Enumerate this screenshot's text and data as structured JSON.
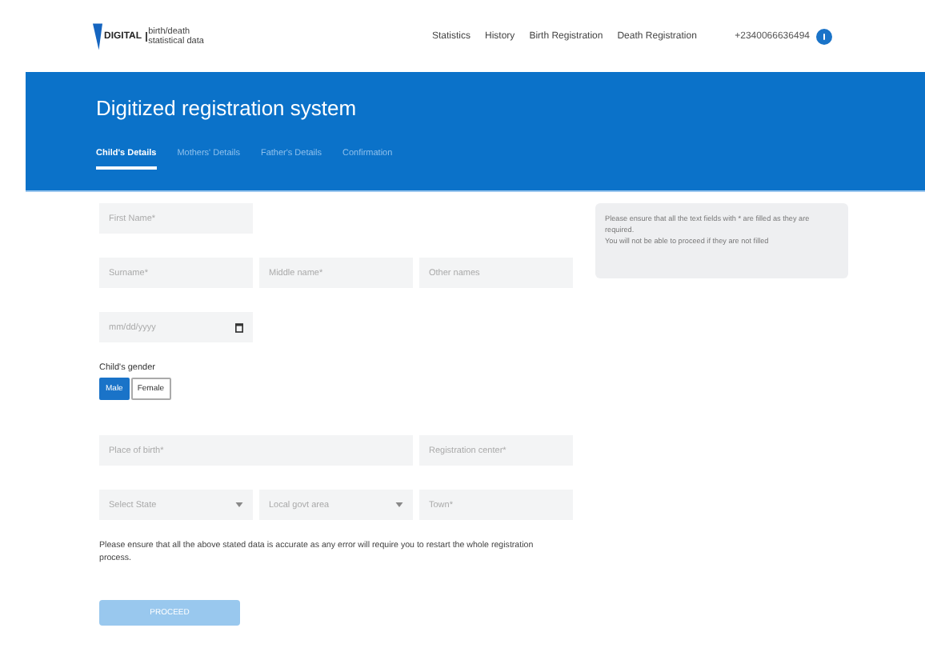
{
  "logo": {
    "mark": "DIGITAL",
    "line_1": "birth/death",
    "line_2": "statistical data"
  },
  "nav": [
    "Statistics",
    "History",
    "Birth Registration",
    "Death Registration"
  ],
  "phone": "+2340066636494",
  "banner": {
    "title": "Digitized registration system"
  },
  "tabs": [
    {
      "label": "Child's Details",
      "selected": true
    },
    {
      "label": "Mothers' Details",
      "selected": false
    },
    {
      "label": "Father's Details",
      "selected": false
    },
    {
      "label": "Confirmation",
      "selected": false
    }
  ],
  "rows": [
    [
      {
        "kind": "text",
        "placeholder": "First Name*"
      }
    ],
    [
      {
        "kind": "text",
        "placeholder": "Surname*"
      },
      {
        "kind": "text",
        "placeholder": "Middle name*"
      },
      {
        "kind": "text",
        "placeholder": "Other names"
      }
    ],
    [
      {
        "kind": "date",
        "placeholder": "mm/dd/yyyy"
      }
    ]
  ],
  "gender": {
    "label": "Child's gender",
    "options": [
      {
        "label": "Male",
        "selected": true
      },
      {
        "label": "Female",
        "selected": false
      }
    ]
  },
  "rows_2": [
    [
      {
        "kind": "text",
        "placeholder": "Place of birth*"
      },
      {
        "kind": "text",
        "placeholder": "Registration center*"
      }
    ],
    [
      {
        "kind": "select",
        "placeholder": "Select State"
      },
      {
        "kind": "select",
        "placeholder": "Local govt area"
      },
      {
        "kind": "text",
        "placeholder": "Town*"
      }
    ]
  ],
  "note": "Please ensure that all the above stated data is accurate as any error will require you to restart the whole registration process.",
  "proceed": {
    "label": "PROCEED",
    "disabled": true
  },
  "info": [
    "Please ensure that all the text fields with * are filled as they are required.",
    "You will not be able to proceed if they are not filled"
  ]
}
